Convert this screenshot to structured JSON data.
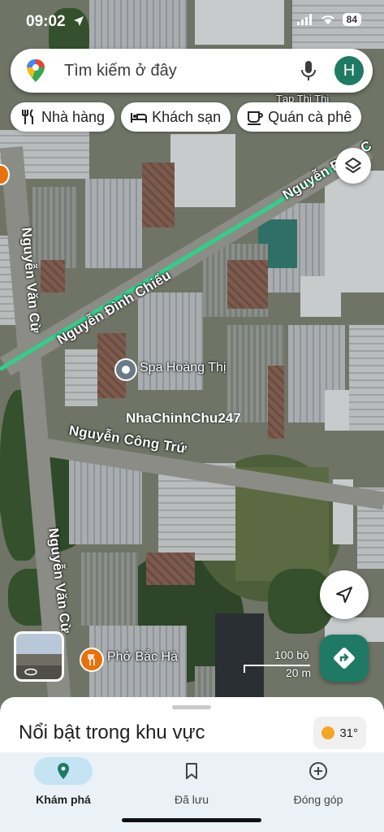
{
  "status": {
    "time": "09:02",
    "battery": "84"
  },
  "search": {
    "placeholder": "Tìm kiếm ở đây",
    "avatar_initial": "H"
  },
  "chips": [
    {
      "label": "Nhà hàng",
      "icon": "fork-knife-icon"
    },
    {
      "label": "Khách sạn",
      "icon": "bed-icon"
    },
    {
      "label": "Quán cà phê",
      "icon": "coffee-cup-icon"
    }
  ],
  "map": {
    "roads": {
      "nguyen_dinh_chieu": "Nguyễn Đình Chiểu",
      "nguyen_dinh_c_top": "Nguyễn Đình C",
      "nguyen_van_cu_top": "Nguyễn Văn Cừ",
      "nguyen_van_cu_bottom": "Nguyễn Văn Cừ",
      "nguyen_cong_tru": "Nguyễn Công Trứ"
    },
    "pois": {
      "spa": "Spa Hoàng Thị",
      "pho": "Phở Bắc Hà",
      "top_right": "Tạp Thị Thị"
    },
    "watermark": "NhaChinhChu247",
    "scale": {
      "imperial": "100 bộ",
      "metric": "20 m"
    },
    "route_color": "#2fd08a"
  },
  "sheet": {
    "title": "Nổi bật trong khu vực",
    "temperature": "31°"
  },
  "nav": [
    {
      "label": "Khám phá",
      "icon": "explore-pin-icon",
      "active": true
    },
    {
      "label": "Đã lưu",
      "icon": "bookmark-icon",
      "active": false
    },
    {
      "label": "Đóng góp",
      "icon": "add-circle-icon",
      "active": false
    }
  ],
  "colors": {
    "accent": "#1f7a65",
    "nav_bg": "#eaf2f7",
    "active_pill": "#c4e4f4"
  }
}
